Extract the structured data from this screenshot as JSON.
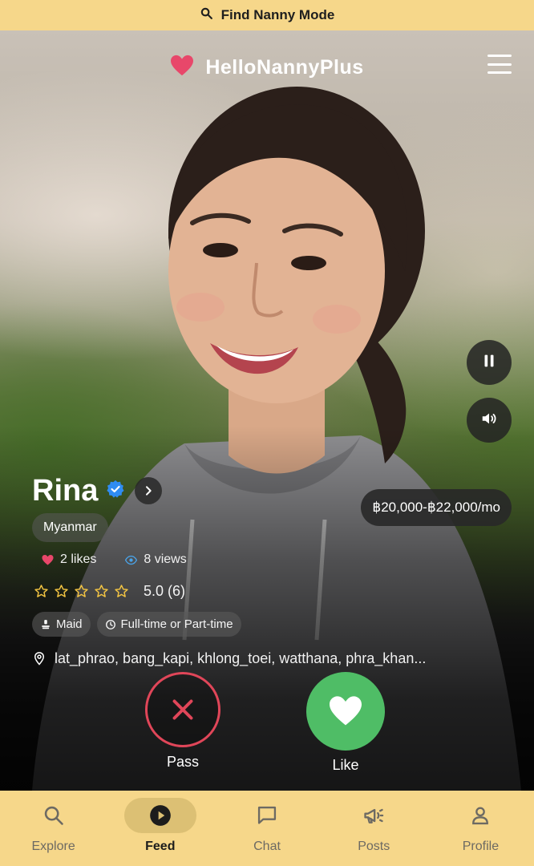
{
  "top_banner": {
    "icon": "search-icon",
    "label": "Find Nanny Mode"
  },
  "header": {
    "brand": "HelloNannyPlus",
    "logo_icon": "heart-icon",
    "menu_icon": "hamburger-menu-icon"
  },
  "media_controls": {
    "pause_icon": "pause-icon",
    "volume_icon": "volume-icon"
  },
  "profile": {
    "name": "Rina",
    "verified_icon": "verified-badge-icon",
    "salary": "฿20,000-฿22,000/mo",
    "nationality": "Myanmar",
    "likes": "2 likes",
    "views": "8 views",
    "rating": 5.0,
    "rating_text": "5.0 (6)",
    "stars_total": 5,
    "tags": [
      {
        "icon": "maid-icon",
        "label": "Maid"
      },
      {
        "icon": "clock-icon",
        "label": "Full-time or Part-time"
      }
    ],
    "locations": "lat_phrao, bang_kapi, khlong_toei, watthana, phra_khan..."
  },
  "actions": {
    "pass_label": "Pass",
    "like_label": "Like"
  },
  "bottom_nav": {
    "items": [
      {
        "label": "Explore",
        "icon": "search-icon",
        "active": false
      },
      {
        "label": "Feed",
        "icon": "play-circle-icon",
        "active": true
      },
      {
        "label": "Chat",
        "icon": "chat-bubble-icon",
        "active": false
      },
      {
        "label": "Posts",
        "icon": "megaphone-icon",
        "active": false
      },
      {
        "label": "Profile",
        "icon": "person-icon",
        "active": false
      }
    ]
  },
  "colors": {
    "banner_bg": "#f6d78a",
    "accent_heart": "#e8476a",
    "pass_red": "#e04659",
    "like_green": "#4fbd66",
    "star_yellow": "#f4c542",
    "verified_blue": "#2f8cf3"
  }
}
